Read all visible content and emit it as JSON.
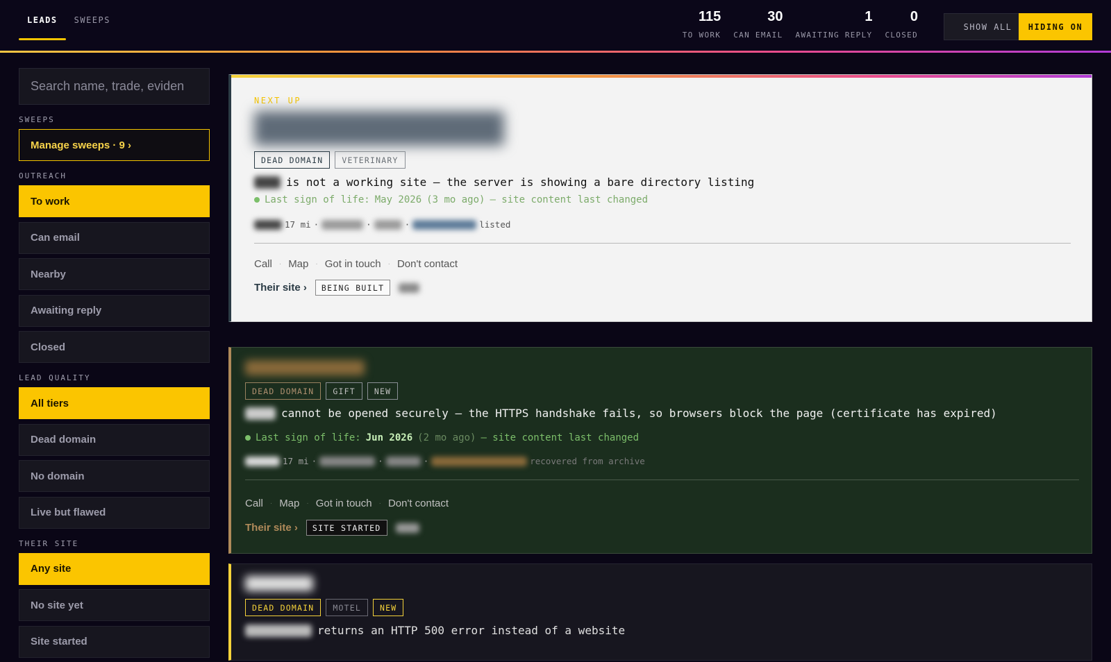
{
  "tabs": [
    {
      "label": "LEADS",
      "active": true
    },
    {
      "label": "SWEEPS",
      "active": false
    }
  ],
  "stats": [
    {
      "value": "115",
      "label": "TO WORK"
    },
    {
      "value": "30",
      "label": "CAN EMAIL"
    },
    {
      "value": "1",
      "label": "AWAITING REPLY"
    },
    {
      "value": "0",
      "label": "CLOSED"
    }
  ],
  "buttons": {
    "show_all": "SHOW ALL",
    "hiding_on": "HIDING ON"
  },
  "search": {
    "placeholder": "Search name, trade, eviden"
  },
  "sidebar": {
    "sweeps_heading": "SWEEPS",
    "manage_label": "Manage sweeps · 9 ›",
    "outreach_heading": "OUTREACH",
    "outreach": [
      "To work",
      "Can email",
      "Nearby",
      "Awaiting reply",
      "Closed"
    ],
    "quality_heading": "LEAD QUALITY",
    "quality": [
      "All tiers",
      "Dead domain",
      "No domain",
      "Live but flawed"
    ],
    "site_heading": "THEIR SITE",
    "site": [
      "Any site",
      "No site yet",
      "Site started"
    ]
  },
  "leads": [
    {
      "next_up": "NEXT UP",
      "tags": [
        "DEAD DOMAIN",
        "VETERINARY"
      ],
      "problem": "is not a working site — the server is showing a bare directory listing",
      "life_prefix": "Last sign of life:",
      "life_date": "May 2026",
      "life_ago": "(3 mo ago)",
      "life_suffix": "— site content last changed",
      "distance": "17 mi",
      "meta_dot": "·",
      "meta_tail": "listed",
      "actions": [
        "Call",
        "Map",
        "Got in touch",
        "Don't contact"
      ],
      "action_sep": "·",
      "site_link": "Their site ›",
      "site_status": "BEING BUILT"
    },
    {
      "tags": [
        "DEAD DOMAIN",
        "GIFT",
        "NEW"
      ],
      "problem": "cannot be opened securely — the HTTPS handshake fails, so browsers block the page (certificate has expired)",
      "life_prefix": "Last sign of life:",
      "life_date": "Jun 2026",
      "life_ago": "(2 mo ago)",
      "life_suffix": "— site content last changed",
      "distance": "17 mi",
      "meta_dot": "·",
      "meta_tail": "recovered from archive",
      "actions": [
        "Call",
        "Map",
        "Got in touch",
        "Don't contact"
      ],
      "action_sep": "·",
      "site_link": "Their site ›",
      "site_status": "SITE STARTED"
    },
    {
      "tags": [
        "DEAD DOMAIN",
        "MOTEL",
        "NEW"
      ],
      "problem": "returns an HTTP 500 error instead of a website"
    }
  ],
  "colors": {
    "accent": "#fbc500",
    "background": "#0a0616",
    "life_green": "#7cbf6a",
    "card_green": "#1b2e1e"
  }
}
